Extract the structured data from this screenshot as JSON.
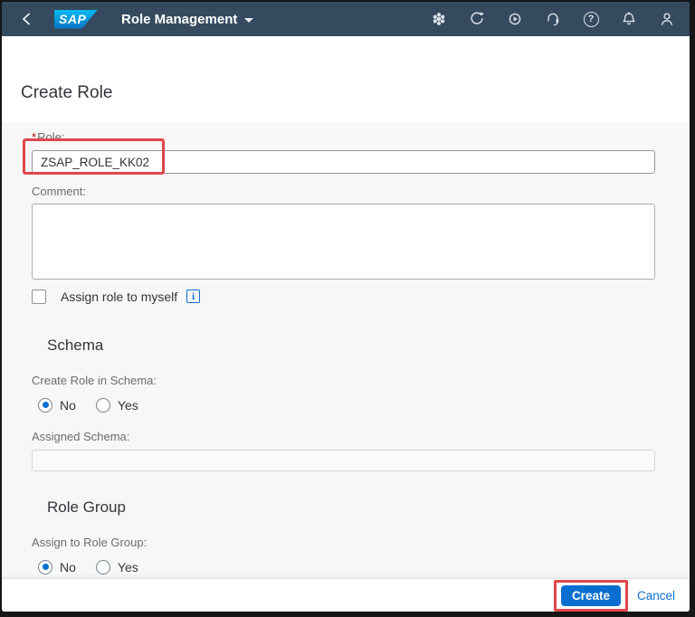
{
  "header": {
    "logo": "SAP",
    "app_title": "Role Management",
    "icons": {
      "back": "chevron-left",
      "product": "module-cluster",
      "refresh": "refresh-arrow",
      "restart": "play-circle",
      "support": "headset",
      "help": "?",
      "notifications": "bell",
      "profile": "person"
    }
  },
  "page": {
    "title": "Create Role"
  },
  "form": {
    "role": {
      "required_marker": "*",
      "label": "Role:",
      "value": "ZSAP_ROLE_KK02"
    },
    "comment": {
      "label": "Comment:",
      "value": ""
    },
    "assign_to_myself": {
      "label": "Assign role to myself",
      "checked": false,
      "info_icon": "i"
    },
    "schema": {
      "heading": "Schema",
      "create_in_schema": {
        "label": "Create Role in Schema:",
        "options": [
          "No",
          "Yes"
        ],
        "selected": "No"
      },
      "assigned_schema": {
        "label": "Assigned Schema:",
        "value": "",
        "disabled": true
      }
    },
    "role_group": {
      "heading": "Role Group",
      "assign_to_group": {
        "label": "Assign to Role Group:",
        "options": [
          "No",
          "Yes"
        ],
        "selected": "No"
      }
    }
  },
  "footer": {
    "create": "Create",
    "cancel": "Cancel"
  },
  "colors": {
    "shell_bar": "#354a5f",
    "accent_blue": "#0a6ed1",
    "annotation_red": "#e0474c",
    "label_gray": "#6a6d70",
    "text_dark": "#32363a",
    "panel_gray": "#f7f7f7"
  }
}
